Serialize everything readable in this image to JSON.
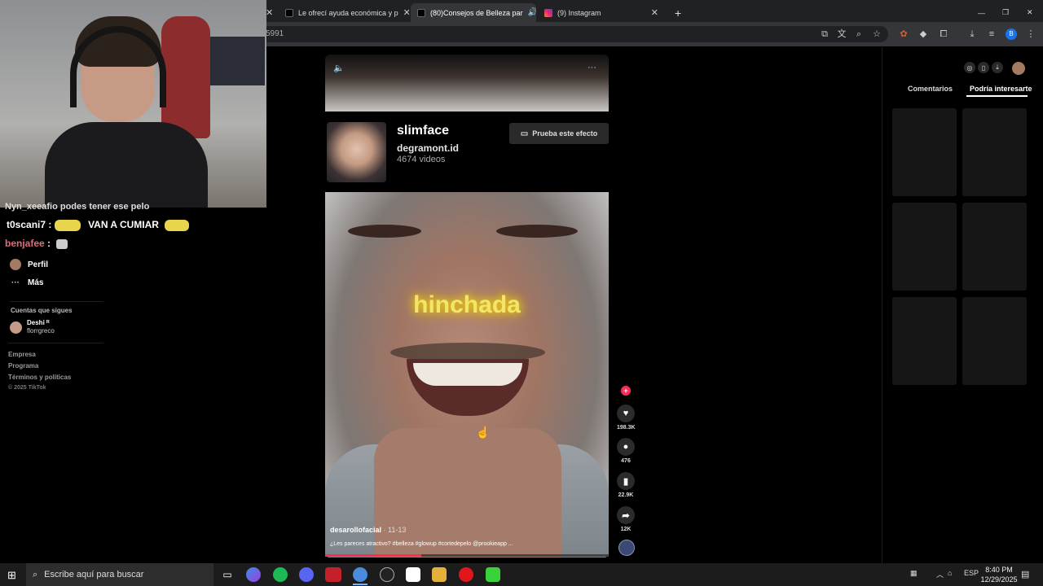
{
  "browser": {
    "tabs": [
      {
        "label": "",
        "active": false
      },
      {
        "label": "Le ofrecí ayuda económica y p",
        "active": false
      },
      {
        "label": "(80)Consejos de Belleza par",
        "active": true
      },
      {
        "label": "(9) Instagram",
        "active": false
      }
    ],
    "new_tab": "+",
    "window_controls": {
      "minimize": "—",
      "restore": "❐",
      "close": "✕"
    },
    "url": "5991"
  },
  "chat": {
    "line1": "Nyn_xeeafio podes tener ese pelo",
    "line2_user": "t0scani7",
    "line2_msg": "VAN A CUMIAR",
    "line3_user": "benjafee",
    "line3_msg": ":"
  },
  "sidebar": {
    "profile": "Perfil",
    "more": "Más",
    "following_heading": "Cuentas que sigues",
    "following": [
      {
        "name": "Deshi ᴿ",
        "handle": "florrgreco"
      }
    ],
    "footer": [
      "Empresa",
      "Programa",
      "Términos y políticas",
      "© 2025 TikTok"
    ]
  },
  "effect": {
    "name": "slimface",
    "creator": "degramont.id",
    "videos": "4674 videos",
    "try_button": "Prueba este efecto"
  },
  "video": {
    "overlay_word": "hinchada",
    "author": "desarollofacial",
    "date": " · 11-13",
    "description": "¿Les pareces atractivo? #belleza #glowup #cortedepelo @prookieapp ...",
    "progress": 0.34
  },
  "actions": {
    "likes": "198.3K",
    "comments": "476",
    "saves": "22.9K",
    "shares": "12K"
  },
  "right_panel": {
    "tabs": [
      "Comentarios",
      "Podría interesarte"
    ],
    "active_tab": "Podría interesarte"
  },
  "taskbar": {
    "search_placeholder": "Escribe aquí para buscar",
    "lang": "ESP",
    "time": "8:40 PM",
    "date": "12/29/2025"
  },
  "colors": {
    "accent": "#fe2c55",
    "chrome_bg": "#202124",
    "toolbar_bg": "#35363a",
    "overlay_text": "#f2e66a"
  }
}
